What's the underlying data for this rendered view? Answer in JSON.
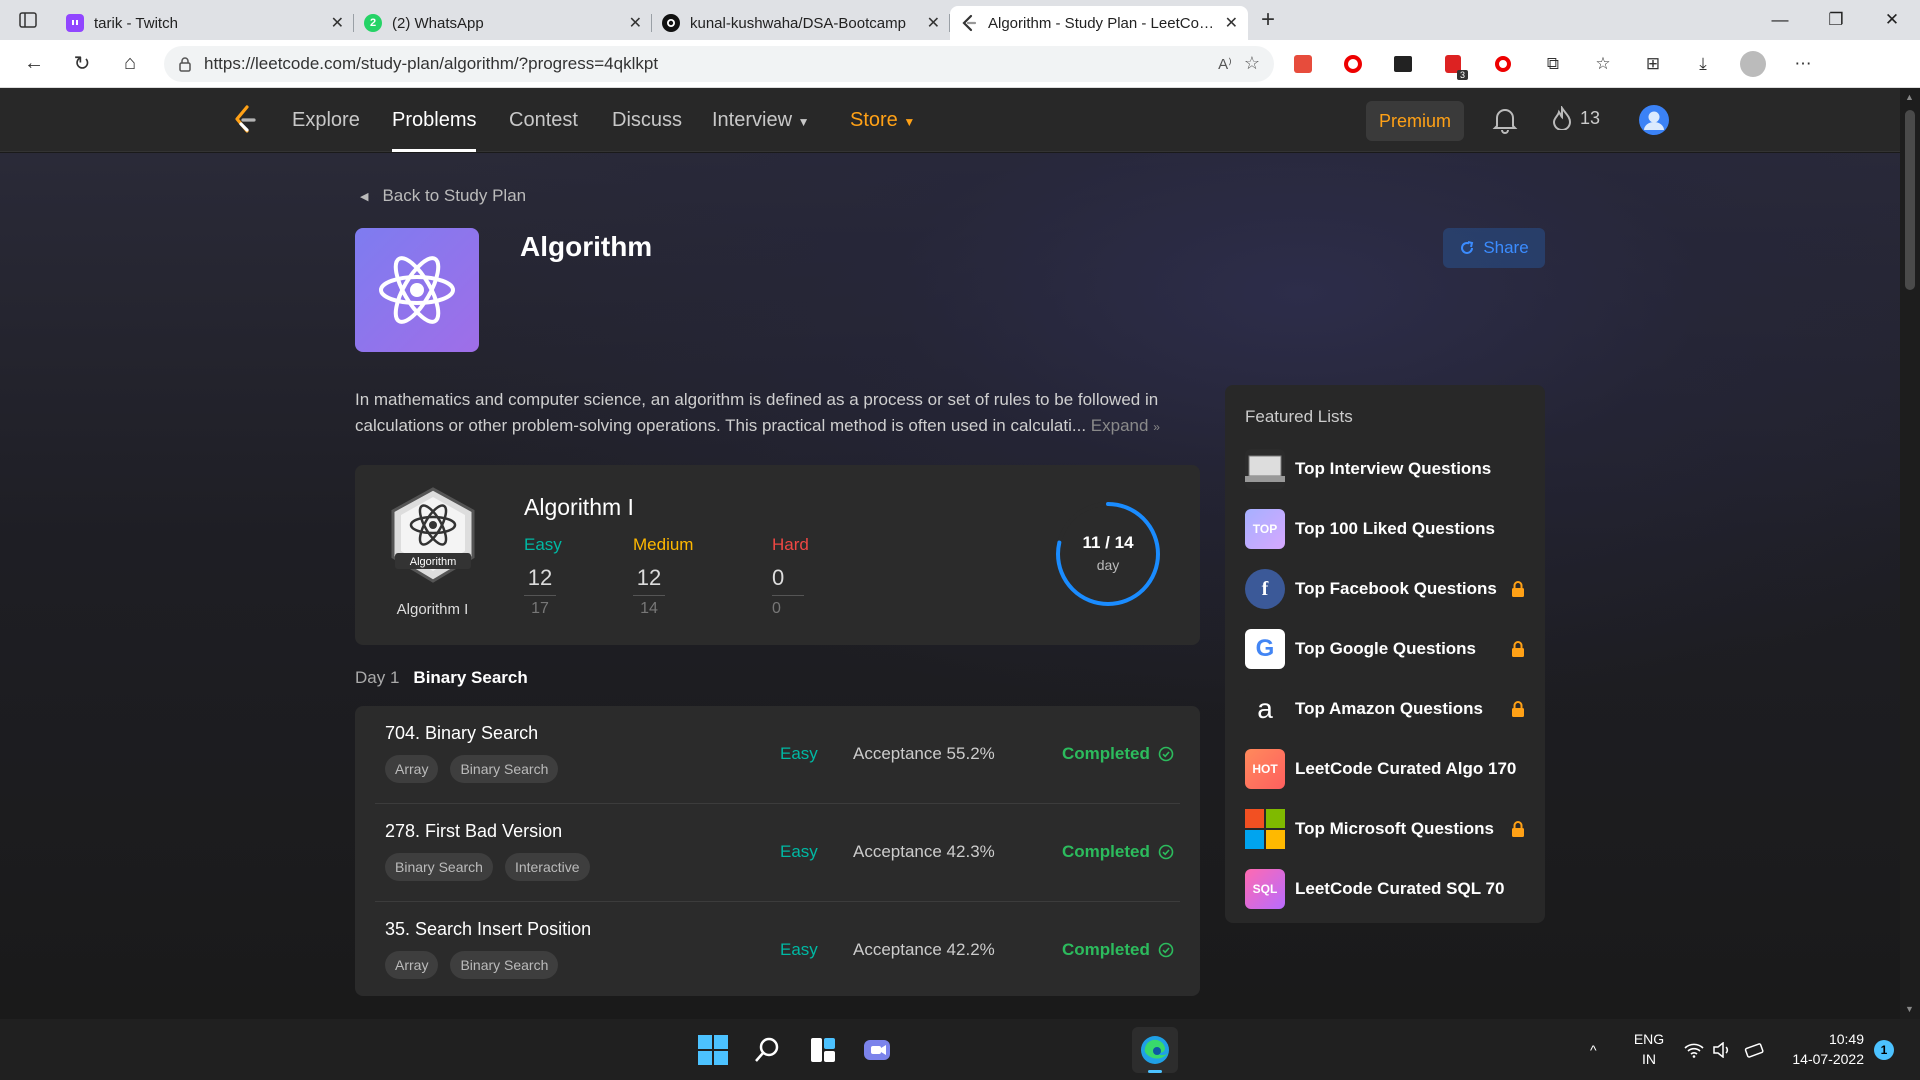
{
  "browser": {
    "tabs": [
      {
        "title": "tarik - Twitch",
        "icon": "twitch-icon"
      },
      {
        "title": "(2) WhatsApp",
        "icon": "whatsapp-icon",
        "badge": "2"
      },
      {
        "title": "kunal-kushwaha/DSA-Bootcamp",
        "icon": "github-icon"
      },
      {
        "title": "Algorithm - Study Plan - LeetCode",
        "icon": "leetcode-icon",
        "active": true
      }
    ],
    "url": "https://leetcode.com/study-plan/algorithm/?progress=4qklkpt",
    "extension_badge": "3"
  },
  "nav": {
    "links": [
      "Explore",
      "Problems",
      "Contest",
      "Discuss",
      "Interview",
      "Store"
    ],
    "active": "Problems",
    "premium_label": "Premium",
    "streak_count": "13"
  },
  "plan": {
    "back_label": "Back to Study Plan",
    "title": "Algorithm",
    "share_label": "Share",
    "description_line1": "In mathematics and computer science, an algorithm is defined as a process or set of rules to be followed in",
    "description_line2": "calculations or other problem-solving operations. This practical method is often used in calculati...",
    "expand_label": "Expand"
  },
  "summary": {
    "badge_text": "Algorithm",
    "badge_label": "Algorithm I",
    "title": "Algorithm I",
    "easy": {
      "label": "Easy",
      "solved": "12",
      "total": "17"
    },
    "medium": {
      "label": "Medium",
      "solved": "12",
      "total": "14"
    },
    "hard": {
      "label": "Hard",
      "solved": "0",
      "total": "0"
    },
    "progress_text": "11 / 14",
    "progress_unit": "day",
    "progress_fraction": 0.7857
  },
  "day": {
    "number": "Day 1",
    "topic": "Binary Search"
  },
  "problems": [
    {
      "title": "704. Binary Search",
      "tags": [
        "Array",
        "Binary Search"
      ],
      "difficulty": "Easy",
      "acceptance": "Acceptance 55.2%",
      "status": "Completed"
    },
    {
      "title": "278. First Bad Version",
      "tags": [
        "Binary Search",
        "Interactive"
      ],
      "difficulty": "Easy",
      "acceptance": "Acceptance 42.3%",
      "status": "Completed"
    },
    {
      "title": "35. Search Insert Position",
      "tags": [
        "Array",
        "Binary Search"
      ],
      "difficulty": "Easy",
      "acceptance": "Acceptance 42.2%",
      "status": "Completed"
    }
  ],
  "featured": {
    "heading": "Featured Lists",
    "items": [
      {
        "label": "Top Interview Questions",
        "icon": "laptop-icon",
        "locked": false
      },
      {
        "label": "Top 100 Liked Questions",
        "icon": "top-icon",
        "icon_text": "TOP",
        "locked": false
      },
      {
        "label": "Top Facebook Questions",
        "icon": "facebook-icon",
        "icon_text": "f",
        "locked": true
      },
      {
        "label": "Top Google Questions",
        "icon": "google-icon",
        "icon_text": "G",
        "locked": true
      },
      {
        "label": "Top Amazon Questions",
        "icon": "amazon-icon",
        "icon_text": "a",
        "locked": true
      },
      {
        "label": "LeetCode Curated Algo 170",
        "icon": "hot-icon",
        "icon_text": "HOT",
        "locked": false
      },
      {
        "label": "Top Microsoft Questions",
        "icon": "microsoft-icon",
        "locked": true
      },
      {
        "label": "LeetCode Curated SQL 70",
        "icon": "sql-icon",
        "icon_text": "SQL",
        "locked": false
      }
    ]
  },
  "taskbar": {
    "language": "ENG",
    "region": "IN",
    "time": "10:49",
    "date": "14-07-2022",
    "notification_count": "1"
  },
  "colors": {
    "easy": "#00b8a3",
    "medium": "#ffb800",
    "hard": "#ef4743",
    "accent": "#ffa116",
    "completed": "#2cbb5d",
    "ring": "#1a8cff"
  }
}
